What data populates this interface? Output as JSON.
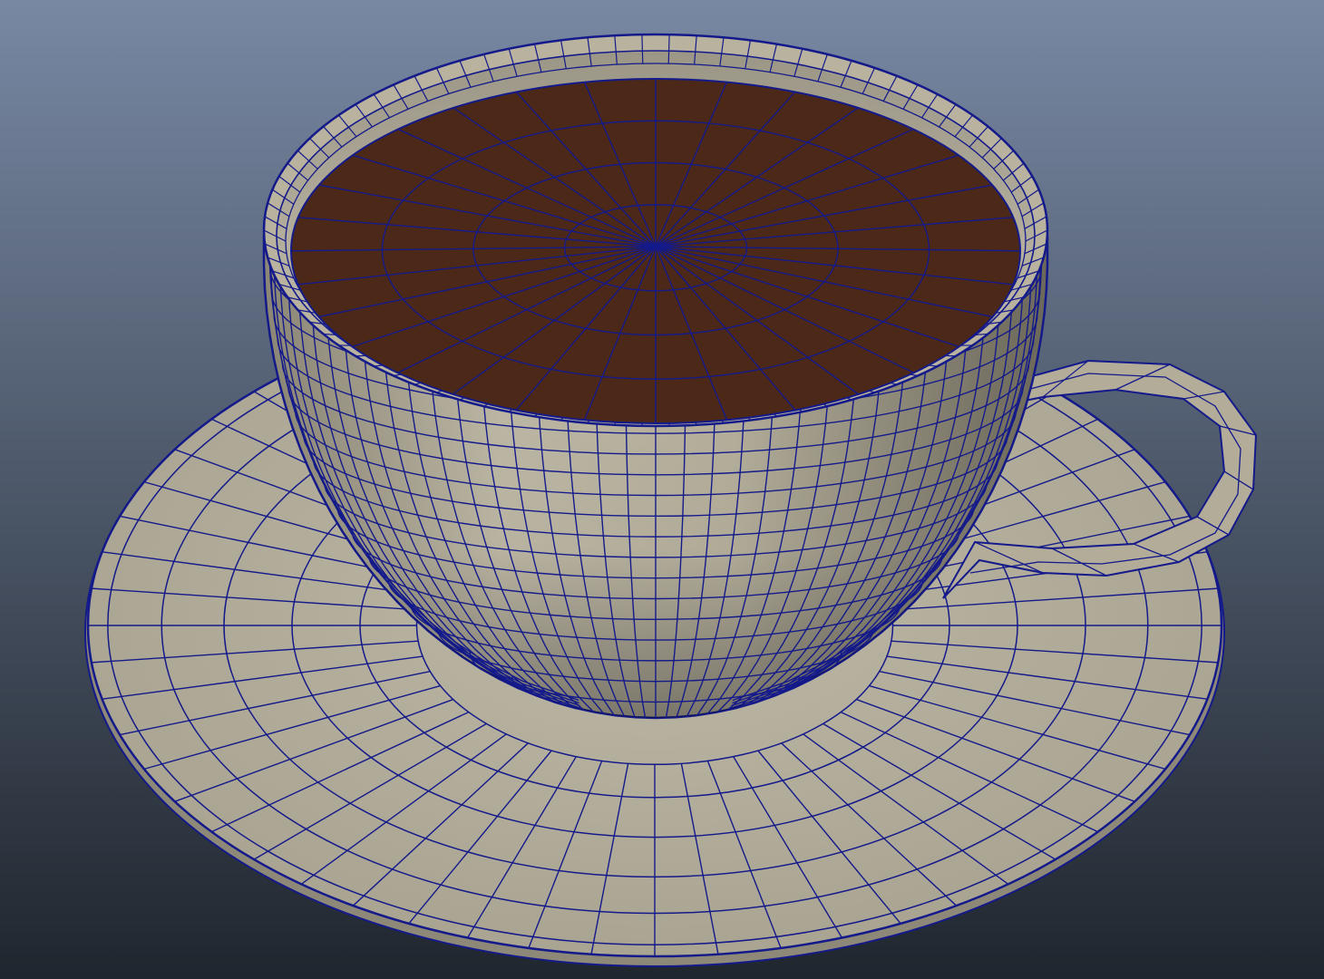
{
  "viewport": {
    "background_top": "#7888a3",
    "background_bottom": "#20262e"
  },
  "scene": {
    "object": "coffee-cup-wireframe",
    "colors": {
      "ceramic": "#b3ad9c",
      "ceramic_dark": "#6b6659",
      "coffee": "#4c2818",
      "wire": "#141a8a"
    }
  }
}
